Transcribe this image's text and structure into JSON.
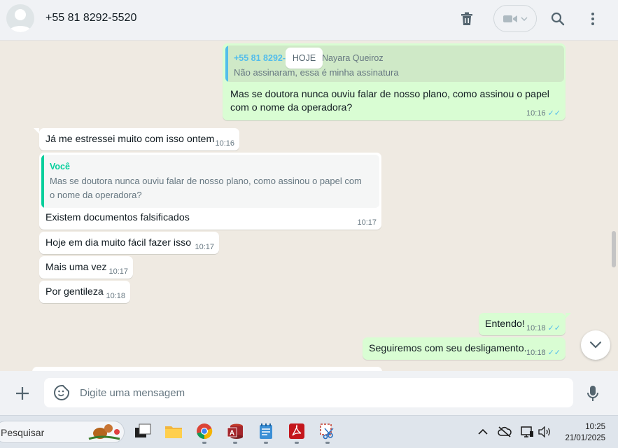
{
  "header": {
    "contact_name": "+55 81 8292-5520"
  },
  "chat": {
    "date_pill": "HOJE",
    "messages": [
      {
        "direction": "out",
        "quote_author": "+55 81 8292-",
        "quote_author_suffix": "Nayara Queiroz",
        "quote_text": "Não assinaram, essa é minha assinatura",
        "text_line1": "Mas se doutora nunca ouviu falar de nosso plano, como assinou o papel",
        "text_line2": "com o nome da operadora?",
        "time": "10:16"
      },
      {
        "direction": "in",
        "text": "Já me estressei muito com isso ontem",
        "time": "10:16"
      },
      {
        "direction": "in",
        "quote_author": "Você",
        "quote_text_line1": "Mas se doutora nunca ouviu falar de nosso plano, como assinou o papel com",
        "quote_text_line2": "o nome da operadora?",
        "text": "Existem documentos falsificados",
        "time": "10:17"
      },
      {
        "direction": "in",
        "text": "Hoje em dia muito fácil fazer isso",
        "time": "10:17"
      },
      {
        "direction": "in",
        "text": "Mais uma vez",
        "time": "10:17"
      },
      {
        "direction": "in",
        "text": "Por gentileza",
        "time": "10:18"
      },
      {
        "direction": "out",
        "text": "Entendo!",
        "time": "10:18"
      },
      {
        "direction": "out",
        "text": "Seguiremos com seu desligamento.",
        "time": "10:18"
      }
    ]
  },
  "composer": {
    "placeholder": "Digite uma mensagem"
  },
  "taskbar": {
    "search_label": "Pesquisar",
    "time": "10:25",
    "date": "21/01/2025"
  },
  "colors": {
    "outgoing_bubble": "#d9fdd3",
    "incoming_bubble": "#ffffff",
    "quote_green": "#06cf9c",
    "quote_blue": "#53bdeb",
    "read_ticks": "#53bdeb"
  }
}
